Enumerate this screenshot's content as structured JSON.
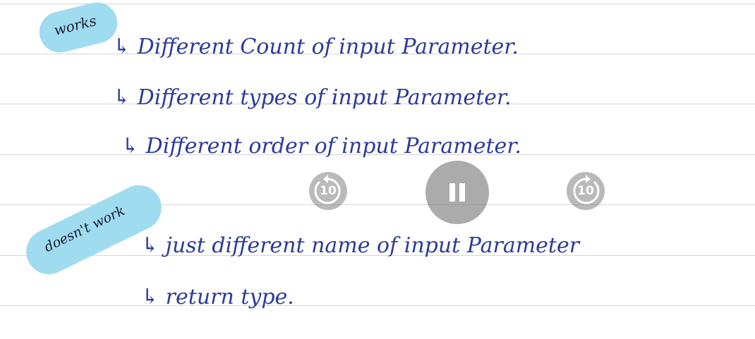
{
  "notes": {
    "works_label": "works",
    "doesnt_work_label": "doesn't work",
    "works_items": [
      "↳ Different Count of input Parameter.",
      "↳ Different types of input Parameter.",
      "↳ Different order of input Parameter."
    ],
    "doesnt_work_items": [
      "↳ just different name of input Parameter",
      "↳ return type."
    ],
    "ink_color": "#2c3a9a",
    "highlight_color": "#9fdcf0"
  },
  "player": {
    "rewind_label": "10",
    "forward_label": "10",
    "rewind_icon": "rewind-10-icon",
    "pause_icon": "pause-icon",
    "forward_icon": "forward-10-icon"
  }
}
